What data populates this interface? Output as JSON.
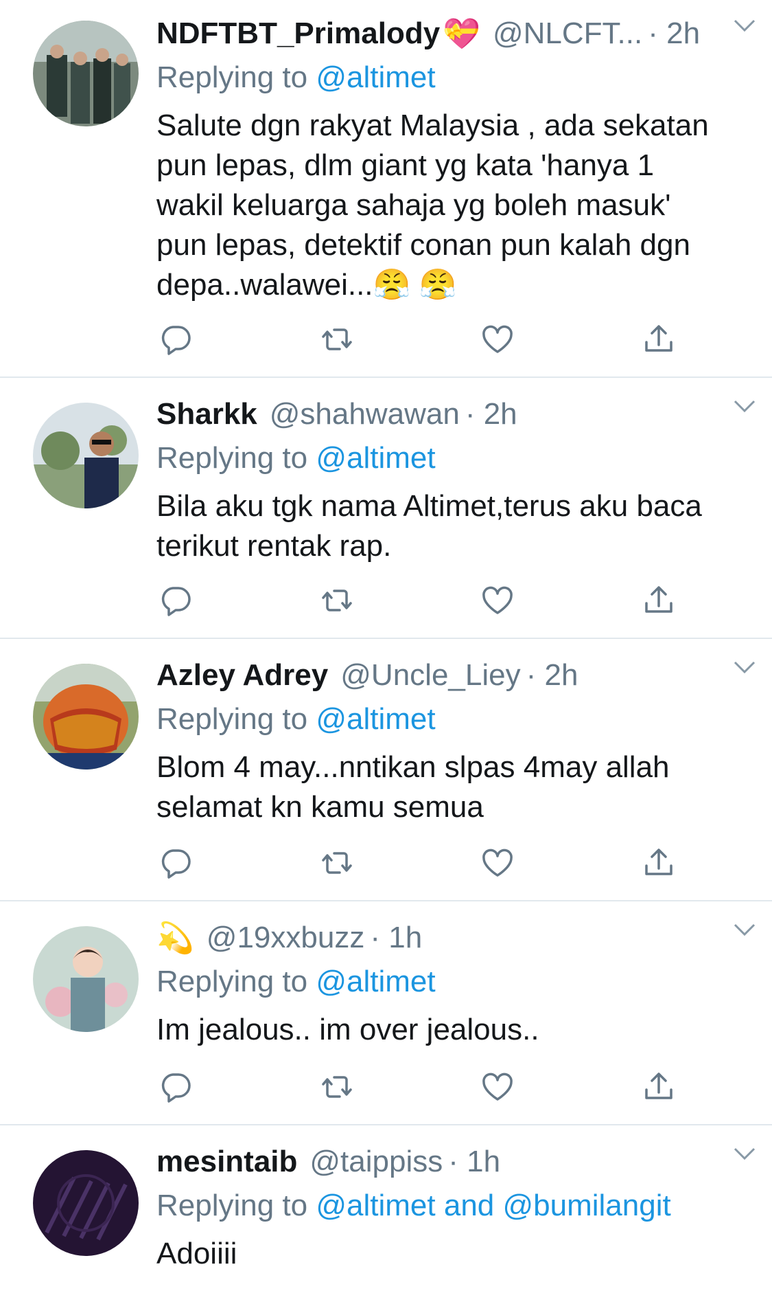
{
  "tweets": [
    {
      "name": "NDFTBT_Primalody",
      "name_emoji": "💝",
      "handle": "@NLCFT...",
      "time": "· 2h",
      "replying_prefix": "Replying to ",
      "replying_to": "@altimet",
      "text": "Salute dgn rakyat Malaysia , ada sekatan\npun lepas, dlm giant yg kata 'hanya 1\nwakil keluarga sahaja yg boleh masuk'\npun lepas, detektif conan pun kalah dgn\ndepa..walawei...😤 😤"
    },
    {
      "name": "Sharkk",
      "name_emoji": "",
      "handle": "@shahwawan",
      "time": "· 2h",
      "replying_prefix": "Replying to ",
      "replying_to": "@altimet",
      "text": "Bila aku tgk nama Altimet,terus aku baca\nterikut rentak rap."
    },
    {
      "name": "Azley Adrey",
      "name_emoji": "",
      "handle": "@Uncle_Liey",
      "time": "· 2h",
      "replying_prefix": "Replying to ",
      "replying_to": "@altimet",
      "text": "Blom 4 may...nntikan slpas 4may allah\nselamat kn kamu semua"
    },
    {
      "name": "",
      "name_emoji": "💫",
      "handle": "@19xxbuzz",
      "time": "· 1h",
      "replying_prefix": "Replying to ",
      "replying_to": "@altimet",
      "text": "Im jealous.. im over jealous.."
    },
    {
      "name": "mesintaib",
      "name_emoji": "",
      "handle": "@taippiss",
      "time": "· 1h",
      "replying_prefix": "Replying to ",
      "replying_to": "@altimet and @bumilangit",
      "text": "Adoiiii"
    }
  ],
  "colors": {
    "link": "#1b95e0",
    "secondary_text": "#657786",
    "divider": "#e1e8ed",
    "icon": "#657786"
  },
  "icons": [
    "reply-icon",
    "retweet-icon",
    "like-icon",
    "share-icon",
    "chevron-down-icon"
  ]
}
